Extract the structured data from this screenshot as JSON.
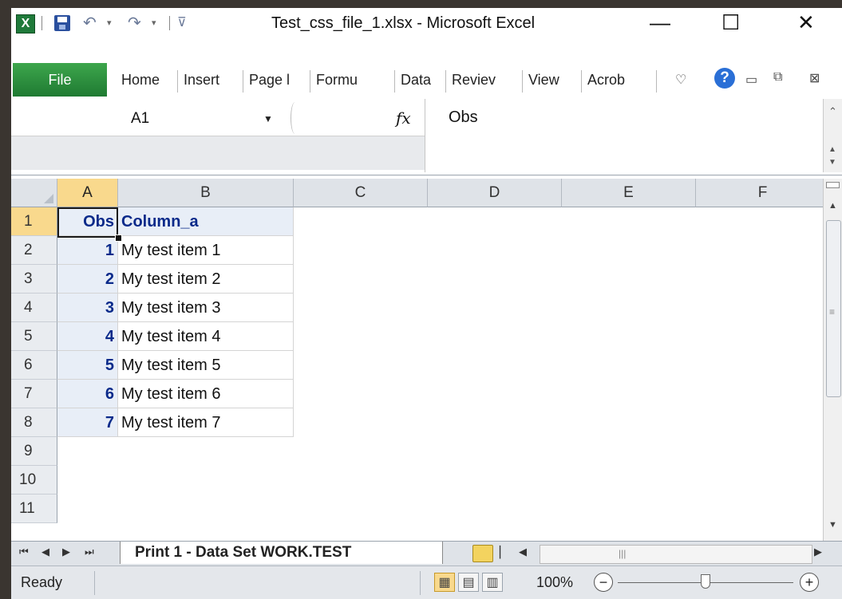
{
  "window": {
    "title": "Test_css_file_1.xlsx  -  Microsoft Excel",
    "app_icon": "X",
    "controls": {
      "minimize": "—",
      "maximize": "☐",
      "close": "✕"
    }
  },
  "quick_access": {
    "undo": "↶",
    "redo": "↷",
    "dropdown": "▾",
    "customize": "⊽"
  },
  "ribbon": {
    "file_tab": "File",
    "tabs": [
      "Home",
      "Insert",
      "Page l",
      "Formu",
      "Data",
      "Reviev",
      "View",
      "Acrob"
    ],
    "help": "?"
  },
  "formula_bar": {
    "name_box": "A1",
    "fx_label": "fx",
    "content": "Obs"
  },
  "grid": {
    "columns": [
      "A",
      "B",
      "C",
      "D",
      "E",
      "F"
    ],
    "rows": [
      "1",
      "2",
      "3",
      "4",
      "5",
      "6",
      "7",
      "8",
      "9",
      "10",
      "11"
    ],
    "header": {
      "a": "Obs",
      "b": "Column_a"
    },
    "data": [
      {
        "a": "1",
        "b": "My test item 1"
      },
      {
        "a": "2",
        "b": "My test item 2"
      },
      {
        "a": "3",
        "b": "My test item 3"
      },
      {
        "a": "4",
        "b": "My test item 4"
      },
      {
        "a": "5",
        "b": "My test item 5"
      },
      {
        "a": "6",
        "b": "My test item 6"
      },
      {
        "a": "7",
        "b": "My test item 7"
      }
    ],
    "active_cell": "A1"
  },
  "sheets": {
    "nav": [
      "⏮",
      "◀",
      "▶",
      "⏭"
    ],
    "active": "Print 1 - Data Set WORK.TEST"
  },
  "status_bar": {
    "state": "Ready",
    "zoom": "100%",
    "zoom_out": "−",
    "zoom_in": "+",
    "zoom_level": 0.5
  },
  "colors": {
    "file_tab": "#2f8a3c",
    "selected_header": "#f9d98d",
    "data_text": "#0a2a8a",
    "table_fill": "#e8eef7"
  }
}
